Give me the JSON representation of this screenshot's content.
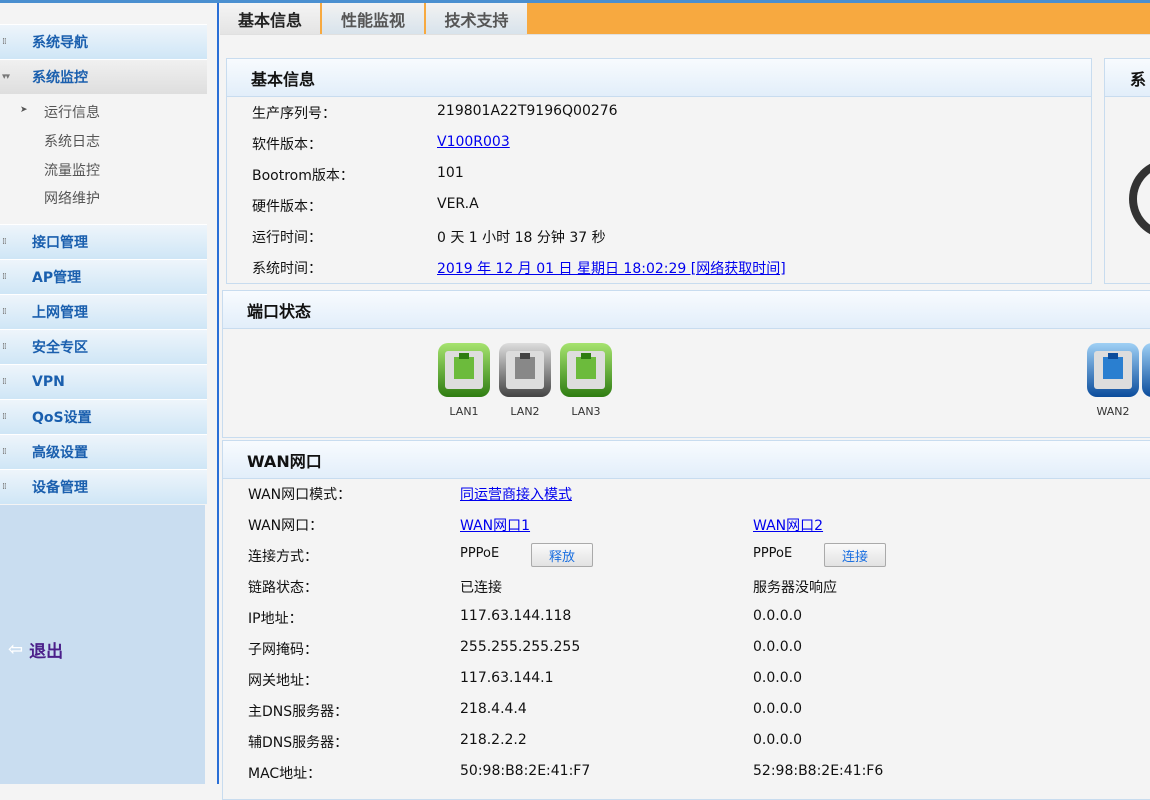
{
  "sidebar": {
    "items": [
      {
        "label": "系统导航"
      },
      {
        "label": "系统监控"
      },
      {
        "label": "接口管理"
      },
      {
        "label": "AP管理"
      },
      {
        "label": "上网管理"
      },
      {
        "label": "安全专区"
      },
      {
        "label": "VPN"
      },
      {
        "label": "QoS设置"
      },
      {
        "label": "高级设置"
      },
      {
        "label": "设备管理"
      }
    ],
    "sub_items": [
      {
        "label": "运行信息"
      },
      {
        "label": "系统日志"
      },
      {
        "label": "流量监控"
      },
      {
        "label": "网络维护"
      }
    ],
    "logout": "退出"
  },
  "tabs": [
    {
      "label": "基本信息"
    },
    {
      "label": "性能监视"
    },
    {
      "label": "技术支持"
    }
  ],
  "basic_info": {
    "title": "基本信息",
    "rows": [
      {
        "label": "生产序列号：",
        "value": "219801A22T9196Q00276"
      },
      {
        "label": "软件版本：",
        "value": "V100R003"
      },
      {
        "label": "Bootrom版本：",
        "value": "101"
      },
      {
        "label": "硬件版本：",
        "value": "VER.A"
      },
      {
        "label": "运行时间：",
        "value": "0 天 1 小时 18 分钟 37 秒"
      },
      {
        "label": "系统时间：",
        "value": "2019 年 12 月 01 日 星期日 18:02:29  [网络获取时间]"
      }
    ]
  },
  "side_panel": {
    "title": "系"
  },
  "ports": {
    "title": "端口状态",
    "items": [
      {
        "label": "LAN1",
        "status": "connected"
      },
      {
        "label": "LAN2",
        "status": "disconnected"
      },
      {
        "label": "LAN3",
        "status": "connected"
      },
      {
        "label": "WAN2",
        "status": "wan"
      }
    ]
  },
  "wan": {
    "title": "WAN网口",
    "mode_label": "WAN网口模式：",
    "mode_value": "同运营商接入模式",
    "port_label": "WAN网口：",
    "port1": "WAN网口1",
    "port2": "WAN网口2",
    "conn_label": "连接方式：",
    "conn1": "PPPoE",
    "conn2": "PPPoE",
    "btn1": "释放",
    "btn2": "连接",
    "rows": [
      {
        "label": "链路状态：",
        "v1": "已连接",
        "v2": "服务器没响应"
      },
      {
        "label": "IP地址：",
        "v1": "117.63.144.118",
        "v2": "0.0.0.0"
      },
      {
        "label": "子网掩码：",
        "v1": "255.255.255.255",
        "v2": "0.0.0.0"
      },
      {
        "label": "网关地址：",
        "v1": "117.63.144.1",
        "v2": "0.0.0.0"
      },
      {
        "label": "主DNS服务器：",
        "v1": "218.4.4.4",
        "v2": "0.0.0.0"
      },
      {
        "label": "辅DNS服务器：",
        "v1": "218.2.2.2",
        "v2": "0.0.0.0"
      },
      {
        "label": "MAC地址：",
        "v1": "50:98:B8:2E:41:F7",
        "v2": "52:98:B8:2E:41:F6"
      }
    ]
  }
}
